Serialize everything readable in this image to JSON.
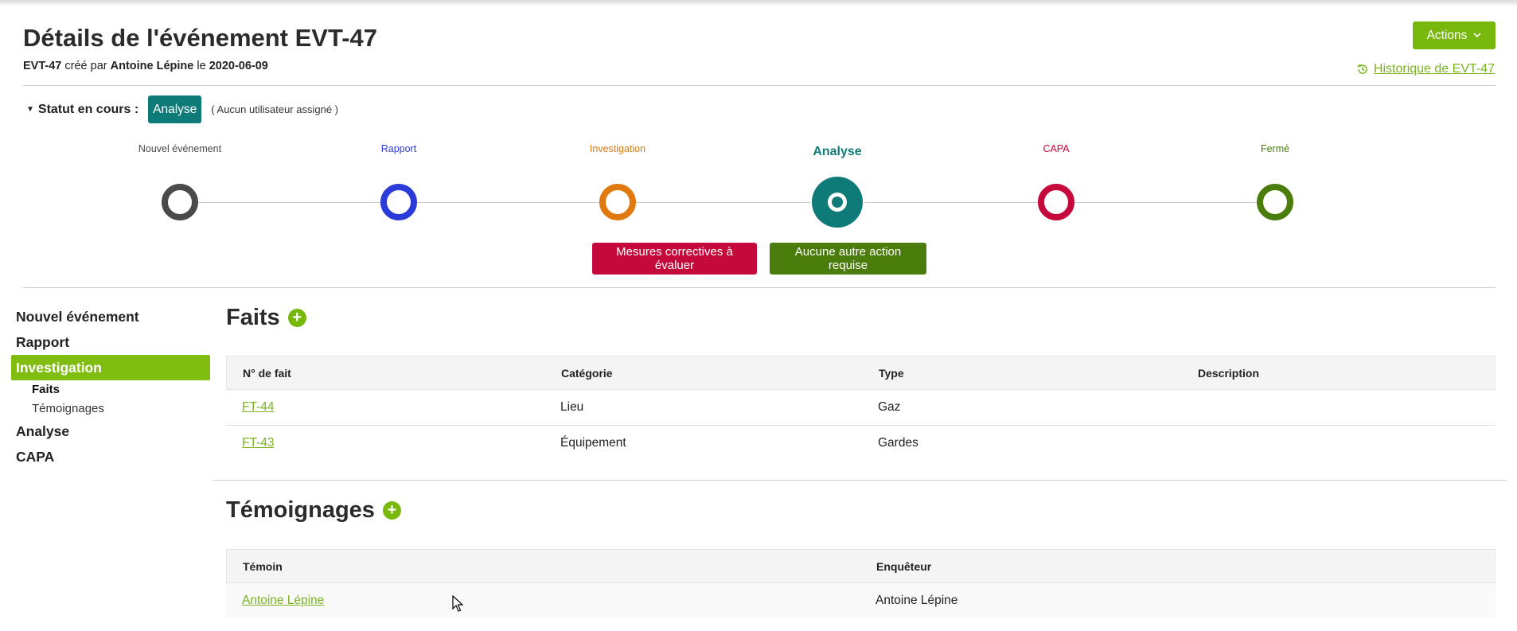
{
  "header": {
    "title": "Détails de l'événement EVT-47",
    "subtitle": {
      "event_id": "EVT-47",
      "created_by_text": " créé par ",
      "author": "Antoine Lépine",
      "on_text": " le ",
      "date": "2020-06-09"
    },
    "actions_label": "Actions",
    "history_label": "Historique de EVT-47"
  },
  "status": {
    "label": "Statut en cours :",
    "badge": "Analyse",
    "note": "( Aucun utilisateur assigné )"
  },
  "stepper": {
    "steps": [
      {
        "label": "Nouvel événement",
        "color": "#4a4a4a"
      },
      {
        "label": "Rapport",
        "color": "#2b3bd8"
      },
      {
        "label": "Investigation",
        "color": "#e07a10"
      },
      {
        "label": "Analyse",
        "color": "#0f7b78"
      },
      {
        "label": "CAPA",
        "color": "#c6093b"
      },
      {
        "label": "Fermé",
        "color": "#4a7d0b"
      }
    ],
    "current_index": 3
  },
  "transitions": {
    "corrective_label": "Mesures correctives à évaluer",
    "no_action_label": "Aucune autre action requise"
  },
  "sidebar": {
    "items": [
      {
        "label": "Nouvel événement"
      },
      {
        "label": "Rapport"
      },
      {
        "label": "Investigation"
      },
      {
        "label": "Faits"
      },
      {
        "label": "Témoignages"
      },
      {
        "label": "Analyse"
      },
      {
        "label": "CAPA"
      }
    ]
  },
  "faits": {
    "title": "Faits",
    "columns": [
      "N° de fait",
      "Catégorie",
      "Type",
      "Description"
    ],
    "rows": [
      {
        "id": "FT-44",
        "category": "Lieu",
        "type": "Gaz",
        "description": ""
      },
      {
        "id": "FT-43",
        "category": "Équipement",
        "type": "Gardes",
        "description": ""
      }
    ]
  },
  "temoignages": {
    "title": "Témoignages",
    "columns": [
      "Témoin",
      "Enquêteur"
    ],
    "rows": [
      {
        "witness": "Antoine Lépine",
        "investigator": "Antoine Lépine"
      }
    ]
  },
  "colors": {
    "accent": "#78b80d",
    "teal": "#0f7b78",
    "red": "#c6093b",
    "dark_green": "#4a7d0b"
  }
}
